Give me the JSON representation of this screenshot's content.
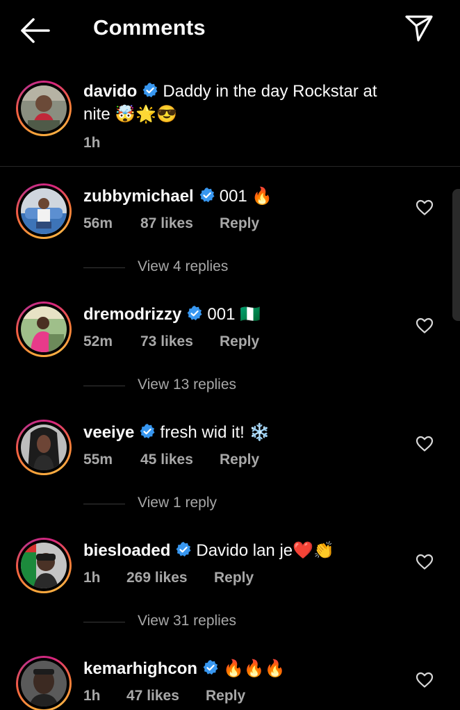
{
  "header": {
    "title": "Comments",
    "back_icon": "arrow-left-icon",
    "share_icon": "paper-plane-icon"
  },
  "caption": {
    "username": "davido",
    "text_line1": "Daddy in the day Rockstar at",
    "text_line2": "nite 🤯🌟😎",
    "time": "1h"
  },
  "comments": [
    {
      "username": "zubbymichael",
      "text": "001 🔥",
      "time": "56m",
      "likes": "87 likes",
      "reply": "Reply",
      "view_replies": "View 4 replies"
    },
    {
      "username": "dremodrizzy",
      "text": "001 🇳🇬",
      "time": "52m",
      "likes": "73 likes",
      "reply": "Reply",
      "view_replies": "View 13 replies"
    },
    {
      "username": "veeiye",
      "text": "fresh wid it! ❄️",
      "time": "55m",
      "likes": "45 likes",
      "reply": "Reply",
      "view_replies": "View 1 reply"
    },
    {
      "username": "biesloaded",
      "text": "Davido lan je❤️👏",
      "time": "1h",
      "likes": "269 likes",
      "reply": "Reply",
      "view_replies": "View 31 replies"
    },
    {
      "username": "kemarhighcon",
      "text": "🔥🔥🔥",
      "time": "1h",
      "likes": "47 likes",
      "reply": "Reply"
    }
  ],
  "colors": {
    "background": "#000000",
    "verified": "#3897f0",
    "secondary_text": "#a8a8a8"
  }
}
